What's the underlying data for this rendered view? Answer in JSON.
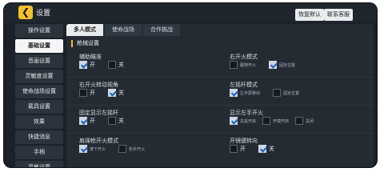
{
  "header": {
    "back_icon": "back-arrow-icon",
    "title": "设置",
    "restore_default": "恢复默认",
    "contact_support": "联系客服"
  },
  "sidebar": {
    "items": [
      {
        "label": "操作设置"
      },
      {
        "label": "基础设置"
      },
      {
        "label": "音画设置"
      },
      {
        "label": "灵敏度设置"
      },
      {
        "label": "使命战场设置"
      },
      {
        "label": "载具设置"
      },
      {
        "label": "效果"
      },
      {
        "label": "快捷消息"
      },
      {
        "label": "手柄"
      },
      {
        "label": "灵敏设置"
      }
    ]
  },
  "tabs": [
    {
      "label": "多人模式"
    },
    {
      "label": "使命战场"
    },
    {
      "label": "合作挑战"
    }
  ],
  "section": {
    "title": "枪械设置"
  },
  "settings": [
    {
      "label": "辅助瞄准",
      "options": [
        {
          "label": "开",
          "checked": true
        },
        {
          "label": "关",
          "checked": false
        }
      ]
    },
    {
      "label": "右开火模式",
      "options": [
        {
          "label": "跟随开火",
          "checked": false,
          "small": true
        },
        {
          "label": "固定位置",
          "checked": true,
          "small": true
        }
      ]
    },
    {
      "label": "右开火转动视角",
      "options": [
        {
          "label": "开",
          "checked": false
        },
        {
          "label": "关",
          "checked": true
        }
      ]
    },
    {
      "label": "左摇杆模式",
      "options": [
        {
          "label": "左半屏移动",
          "checked": true,
          "small": true
        },
        {
          "label": "固定位置",
          "checked": false,
          "small": true
        }
      ]
    },
    {
      "label": "固定显示左摇杆",
      "options": [
        {
          "label": "开",
          "checked": true
        },
        {
          "label": "关",
          "checked": false
        }
      ]
    },
    {
      "label": "显示左手开火",
      "options": [
        {
          "label": "总是开启",
          "checked": true
        },
        {
          "label": "开镜开启",
          "checked": false
        },
        {
          "label": "关闭",
          "checked": false
        }
      ]
    },
    {
      "label": "肩弹枪开火模式",
      "options": [
        {
          "label": "按下开火",
          "checked": true
        },
        {
          "label": "松手开火",
          "checked": false
        }
      ]
    },
    {
      "label": "开镜键转向",
      "options": [
        {
          "label": "开",
          "checked": false
        },
        {
          "label": "关",
          "checked": true
        }
      ]
    }
  ],
  "colors": {
    "accent": "#f2c12e",
    "check": "#1e5fbf",
    "panel": "#242b33"
  }
}
